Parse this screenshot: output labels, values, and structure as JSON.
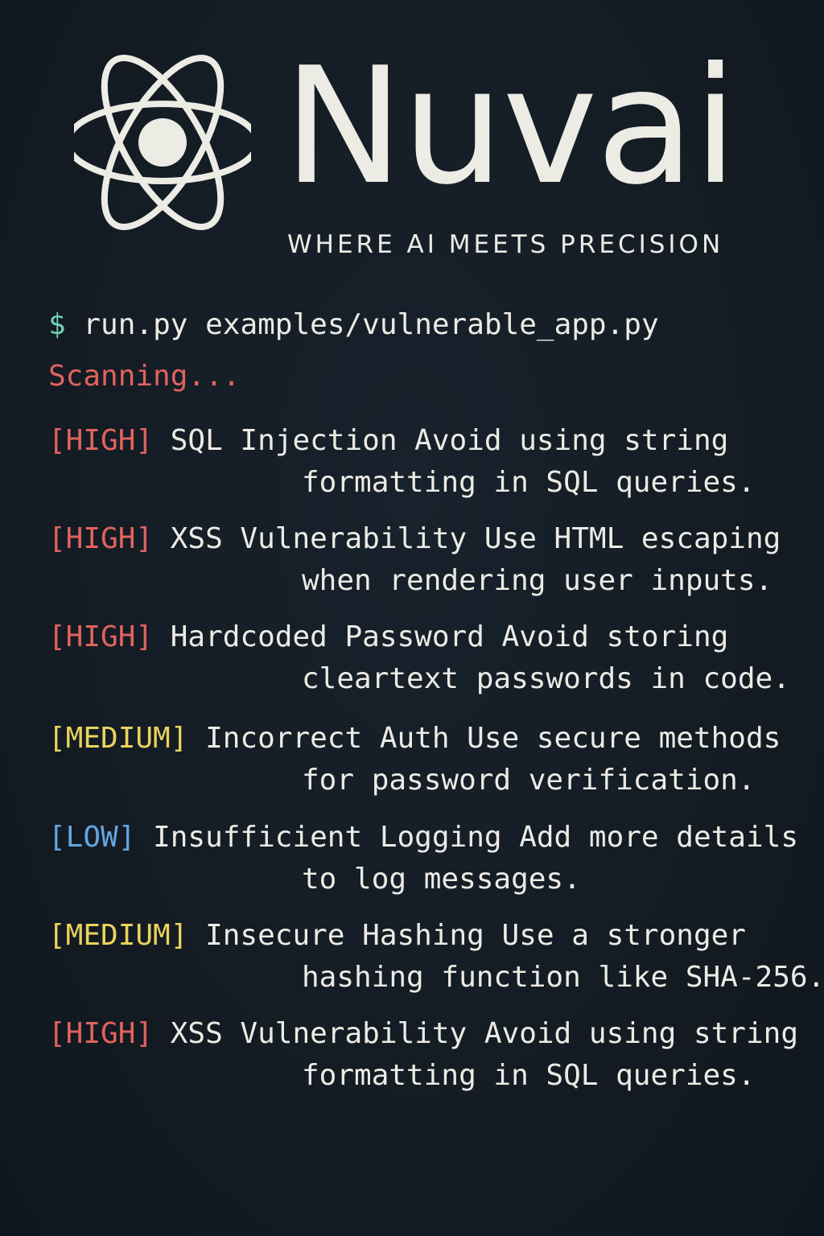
{
  "brand": {
    "name": "Nuvai",
    "tagline": "WHERE AI MEETS PRECISION",
    "logo_icon": "atom-icon"
  },
  "terminal": {
    "prompt": "$",
    "command": "run.py",
    "argument": "examples/vulnerable_app.py",
    "status": "Scanning...",
    "findings": [
      {
        "severity": "[HIGH]",
        "line1": "SQL Injection Avoid using string",
        "line2": "formatting in SQL queries."
      },
      {
        "severity": "[HIGH]",
        "line1": "XSS Vulnerability Use HTML escaping",
        "line2": "when rendering user inputs."
      },
      {
        "severity": "[HIGH]",
        "line1": "Hardcoded Password Avoid storing",
        "line2": "cleartext passwords in code."
      },
      {
        "severity": "[MEDIUM]",
        "line1": "Incorrect Auth Use secure methods",
        "line2": "for password verification."
      },
      {
        "severity": "[LOW]",
        "line1": "Insufficient Logging Add more details",
        "line2": "to log messages."
      },
      {
        "severity": "[MEDIUM]",
        "line1": "Insecure Hashing Use a stronger",
        "line2": "hashing function like SHA-256."
      },
      {
        "severity": "[HIGH]",
        "line1": "XSS Vulnerability Avoid using string",
        "line2": "formatting in SQL queries."
      }
    ]
  },
  "colors": {
    "background": "#141c24",
    "text": "#ecebe4",
    "prompt": "#6fd3b4",
    "high": "#e0635e",
    "medium": "#e9d35b",
    "low": "#63a6e0"
  }
}
